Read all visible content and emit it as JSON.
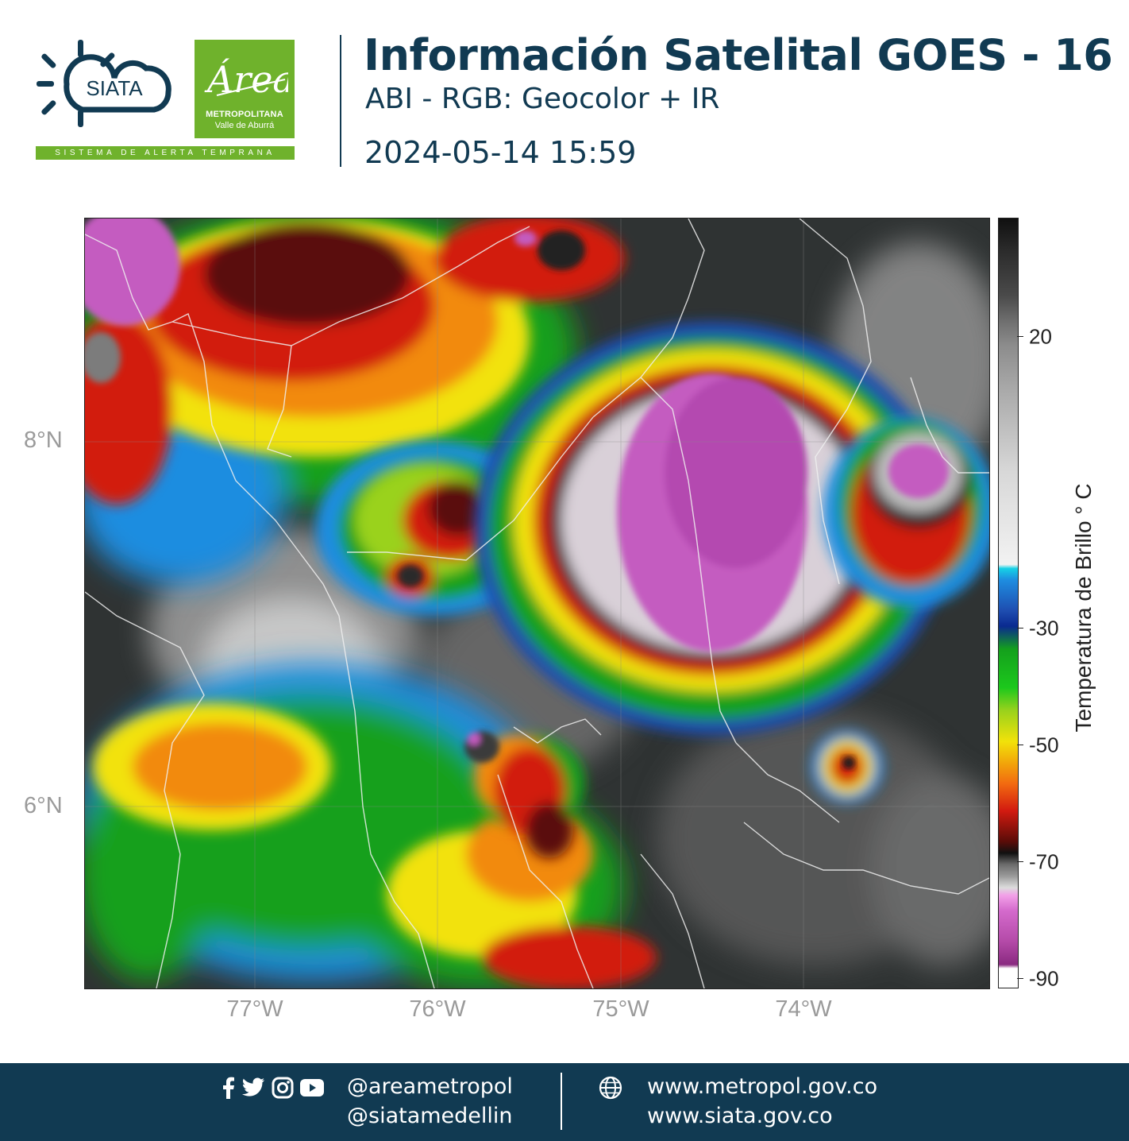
{
  "header": {
    "siata_logo_text": "SIATA",
    "area_logo_script": "Área",
    "area_logo_line1": "METROPOLITANA",
    "area_logo_line2": "Valle de Aburrá",
    "alert_strip": "SISTEMA DE ALERTA TEMPRANA",
    "title": "Información Satelital GOES - 16",
    "subtitle": "ABI - RGB: Geocolor + IR",
    "datetime": "2024-05-14 15:59"
  },
  "map": {
    "lat_labels": [
      "8°N",
      "6°N"
    ],
    "lon_labels": [
      "77°W",
      "76°W",
      "75°W",
      "74°W"
    ],
    "lat_values": [
      8,
      6
    ],
    "lon_values": [
      -77,
      -76,
      -75,
      -74
    ],
    "extent": {
      "lon_min": -77.93,
      "lon_max": -72.98,
      "lat_min": 5.06,
      "lat_max": 9.28
    }
  },
  "colorbar": {
    "title": "Temperatura de Brillo  ° C",
    "ticks": [
      {
        "label": "20",
        "value": 20
      },
      {
        "label": "-30",
        "value": -30
      },
      {
        "label": "-50",
        "value": -50
      },
      {
        "label": "-70",
        "value": -70
      },
      {
        "label": "-90",
        "value": -90
      }
    ],
    "range": [
      -92,
      40
    ]
  },
  "footer": {
    "social_icons": [
      "facebook-icon",
      "twitter-icon",
      "instagram-icon",
      "youtube-icon"
    ],
    "handle1": "@areametropol",
    "handle2": "@siatamedellin",
    "url1": "www.metropol.gov.co",
    "url2": "www.siata.gov.co",
    "globe_icon": "globe-icon"
  }
}
